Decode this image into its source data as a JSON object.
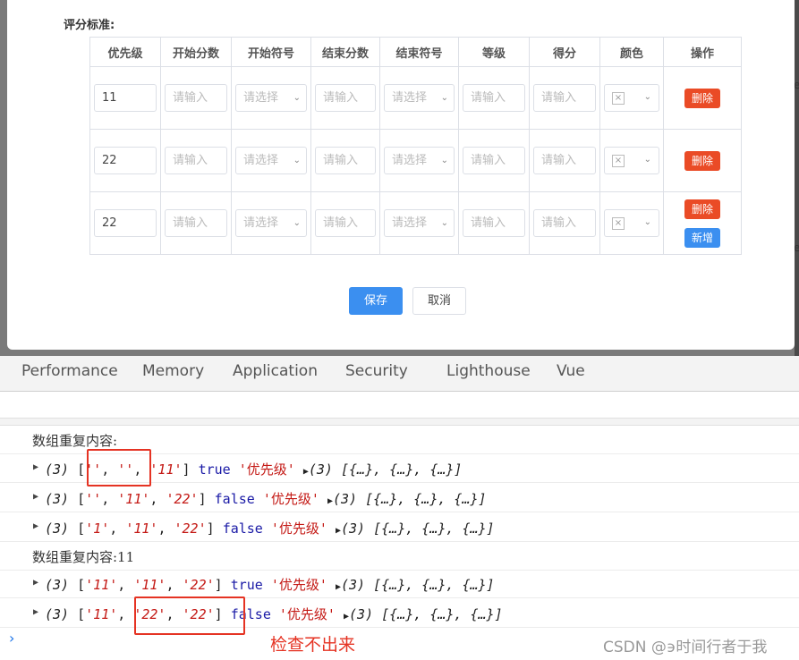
{
  "form": {
    "section_title": "评分标准:",
    "columns": [
      "优先级",
      "开始分数",
      "开始符号",
      "结束分数",
      "结束符号",
      "等级",
      "得分",
      "颜色",
      "操作"
    ],
    "rows": [
      {
        "priority": "11",
        "start_score": "请输入",
        "start_symbol": "请选择",
        "end_score": "请输入",
        "end_symbol": "请选择",
        "level": "请输入",
        "score": "请输入",
        "delete_label": "删除"
      },
      {
        "priority": "22",
        "start_score": "请输入",
        "start_symbol": "请选择",
        "end_score": "请输入",
        "end_symbol": "请选择",
        "level": "请输入",
        "score": "请输入",
        "delete_label": "删除"
      },
      {
        "priority": "22",
        "start_score": "请输入",
        "start_symbol": "请选择",
        "end_score": "请输入",
        "end_symbol": "请选择",
        "level": "请输入",
        "score": "请输入",
        "delete_label": "删除",
        "add_label": "新增"
      }
    ],
    "save_label": "保存",
    "cancel_label": "取消"
  },
  "devtools": {
    "tabs": [
      "Performance",
      "Memory",
      "Application",
      "Security",
      "Lighthouse",
      "Vue"
    ],
    "console": {
      "line1": "数组重复内容:",
      "line2": {
        "count": "(3)",
        "items": [
          "''",
          "''",
          "'11'"
        ],
        "bool": "true",
        "field": "'优先级'",
        "obj": "(3) [{…}, {…}, {…}]"
      },
      "line3": {
        "count": "(3)",
        "items": [
          "''",
          "'11'",
          "'22'"
        ],
        "bool": "false",
        "field": "'优先级'",
        "obj": "(3) [{…}, {…}, {…}]"
      },
      "line4": {
        "count": "(3)",
        "items": [
          "'1'",
          "'11'",
          "'22'"
        ],
        "bool": "false",
        "field": "'优先级'",
        "obj": "(3) [{…}, {…}, {…}]"
      },
      "line5": "数组重复内容:11",
      "line6": {
        "count": "(3)",
        "items": [
          "'11'",
          "'11'",
          "'22'"
        ],
        "bool": "true",
        "field": "'优先级'",
        "obj": "(3) [{…}, {…}, {…}]"
      },
      "line7": {
        "count": "(3)",
        "items": [
          "'11'",
          "'22'",
          "'22'"
        ],
        "bool": "false",
        "field": "'优先级'",
        "obj": "(3) [{…}, {…}, {…}]"
      }
    }
  },
  "annotation": "检查不出来",
  "watermark": "CSDN @϶时间行者于我",
  "colors": {
    "delete": "#ea4b26",
    "primary": "#3b8ff0",
    "annotation_red": "#e53323"
  }
}
